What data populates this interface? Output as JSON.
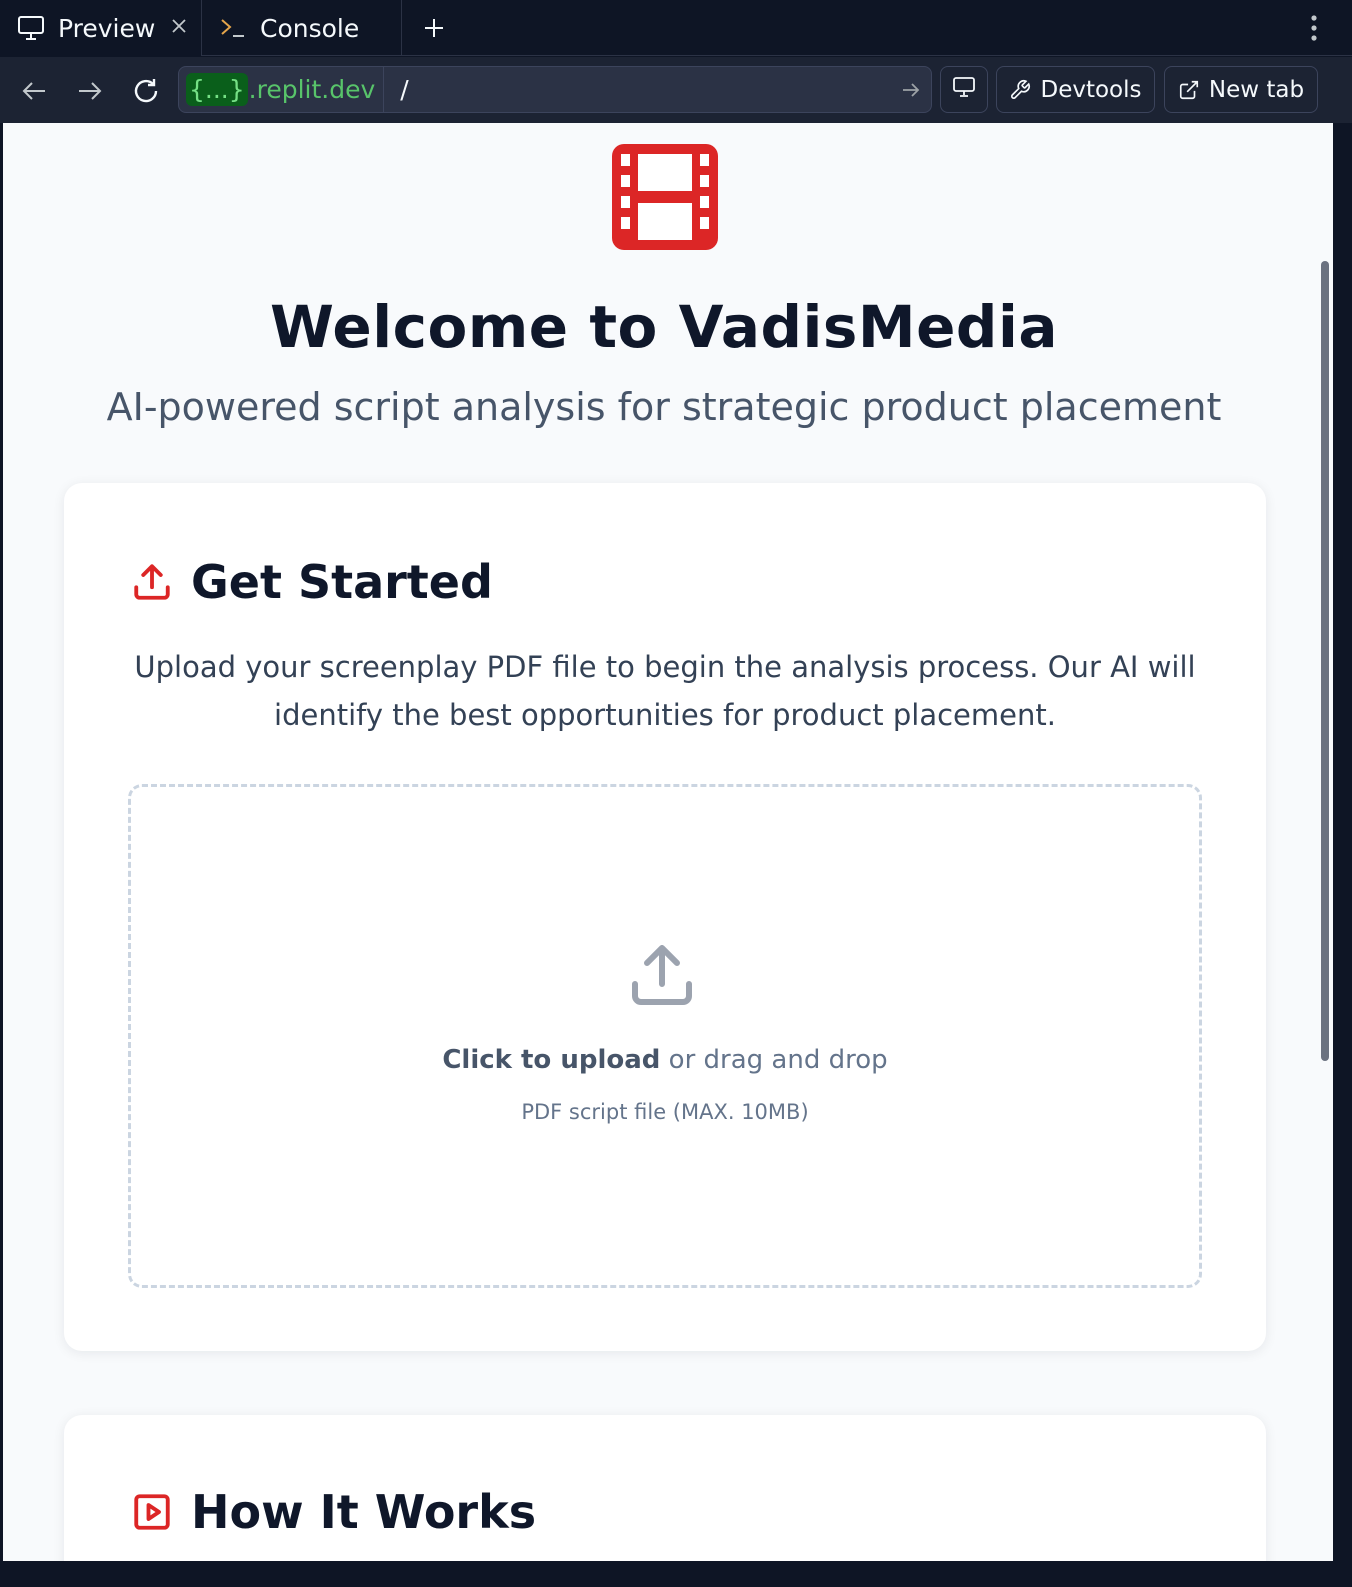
{
  "browser": {
    "tabs": [
      {
        "label": "Preview",
        "icon": "monitor-icon",
        "active": true
      },
      {
        "label": "Console",
        "icon": "terminal-icon",
        "active": false
      }
    ],
    "url": {
      "host_badge": "{...}",
      "host_domain": ".replit.dev",
      "path": "/"
    },
    "buttons": {
      "devtools": "Devtools",
      "new_tab": "New tab"
    }
  },
  "page": {
    "title": "Welcome to VadisMedia",
    "subtitle": "AI-powered script analysis for strategic product placement",
    "logo_icon": "film-icon",
    "accent_color": "#dc2626"
  },
  "get_started": {
    "title": "Get Started",
    "icon": "upload-icon",
    "description": "Upload your screenplay PDF file to begin the analysis process. Our AI will identify the best opportunities for product placement.",
    "dropzone": {
      "strong": "Click to upload",
      "rest": " or drag and drop",
      "hint": "PDF script file (MAX. 10MB)",
      "icon": "upload-icon"
    }
  },
  "how_it_works": {
    "title": "How It Works",
    "icon": "play-square-icon"
  }
}
